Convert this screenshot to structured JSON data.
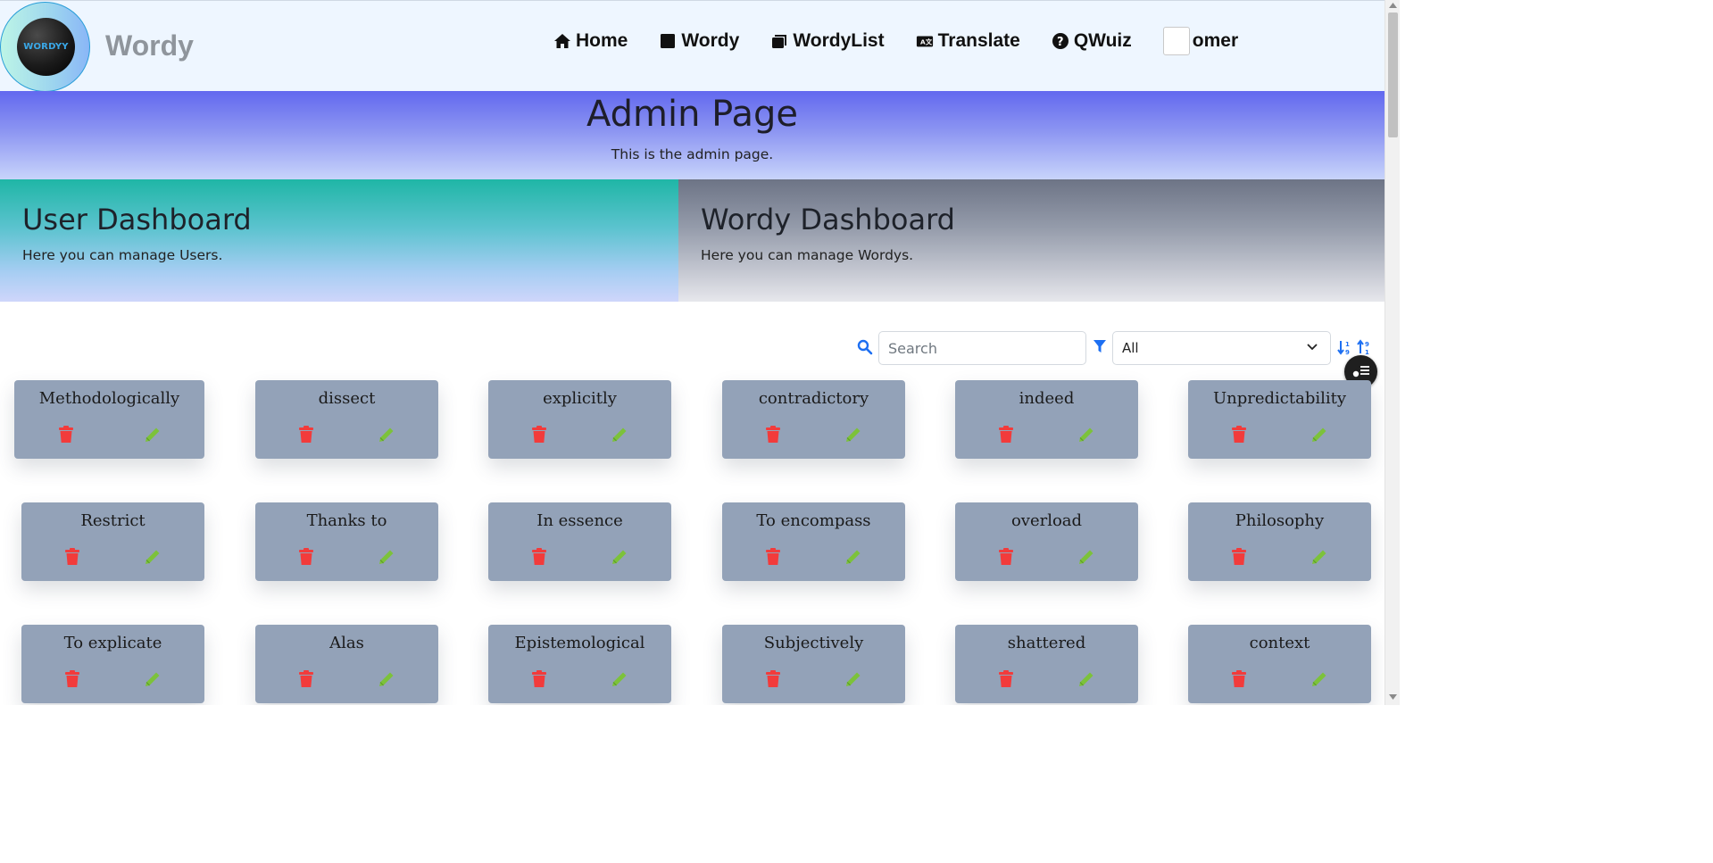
{
  "brand": {
    "logo_text": "WORDYY",
    "name": "Wordy"
  },
  "nav": {
    "items": [
      {
        "label": "Home",
        "icon": "home-icon"
      },
      {
        "label": "Wordy",
        "icon": "square-icon"
      },
      {
        "label": "WordyList",
        "icon": "clone-icon"
      },
      {
        "label": "Translate",
        "icon": "language-icon"
      },
      {
        "label": "QWuiz",
        "icon": "question-circle-icon"
      }
    ],
    "user": {
      "label": "omer",
      "icon": "avatar-image"
    }
  },
  "admin": {
    "title": "Admin Page",
    "subtitle": "This is the admin page."
  },
  "dashboards": {
    "user": {
      "title": "User Dashboard",
      "description": "Here you can manage Users."
    },
    "wordy": {
      "title": "Wordy Dashboard",
      "description": "Here you can manage Wordys."
    }
  },
  "controls": {
    "search_placeholder": "Search",
    "filter_value": "All",
    "accent": "#1d6ff2"
  },
  "colors": {
    "card_bg": "#93a2b8",
    "delete": "#f23b3b",
    "edit": "#7cc23a"
  },
  "words": [
    "Methodologically",
    "dissect",
    "explicitly",
    "contradictory",
    "indeed",
    "Unpredictability",
    "Restrict",
    "Thanks to",
    "In essence",
    "To encompass",
    "overload",
    "Philosophy",
    "To explicate",
    "Alas",
    "Epistemological",
    "Subjectively",
    "shattered",
    "context"
  ]
}
